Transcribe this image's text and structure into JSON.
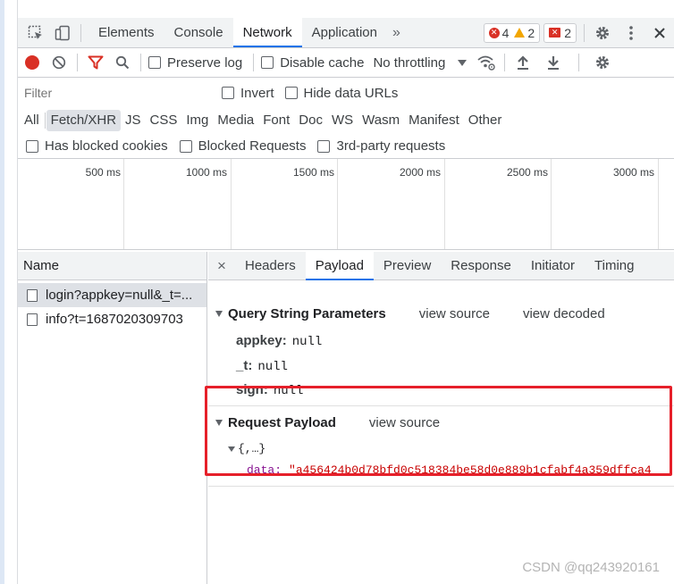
{
  "tabs": {
    "elements": "Elements",
    "console": "Console",
    "network": "Network",
    "application": "Application",
    "more": "»",
    "errors_count": "4",
    "warnings_count": "2",
    "issues_count": "2"
  },
  "toolbar": {
    "preserve_log": "Preserve log",
    "disable_cache": "Disable cache",
    "throttling": "No throttling"
  },
  "filter": {
    "placeholder": "Filter",
    "invert": "Invert",
    "hide_data_urls": "Hide data URLs"
  },
  "types": [
    "All",
    "Fetch/XHR",
    "JS",
    "CSS",
    "Img",
    "Media",
    "Font",
    "Doc",
    "WS",
    "Wasm",
    "Manifest",
    "Other"
  ],
  "blocked": {
    "has_blocked_cookies": "Has blocked cookies",
    "blocked_requests": "Blocked Requests",
    "third_party": "3rd-party requests"
  },
  "overview": {
    "ticks": [
      "500 ms",
      "1000 ms",
      "1500 ms",
      "2000 ms",
      "2500 ms",
      "3000 ms"
    ]
  },
  "requests": {
    "header": "Name",
    "items": [
      {
        "name": "login?appkey=null&_t=..."
      },
      {
        "name": "info?t=1687020309703"
      }
    ]
  },
  "details": {
    "close": "×",
    "tabs": [
      "Headers",
      "Payload",
      "Preview",
      "Response",
      "Initiator",
      "Timing"
    ],
    "active_tab": "Payload",
    "query": {
      "title": "Query String Parameters",
      "view_source": "view source",
      "view_decoded": "view decoded",
      "params": [
        {
          "key": "appkey:",
          "value": "null"
        },
        {
          "key": "_t:",
          "value": "null"
        },
        {
          "key": "sign:",
          "value": "null"
        }
      ]
    },
    "payload": {
      "title": "Request Payload",
      "view_source": "view source",
      "object_summary": "{,…}",
      "data_key": "data:",
      "data_value": "\"a456424b0d78bfd0c518384be58d0e889b1cfabf4a359dffca4"
    }
  },
  "watermark": "CSDN @qq243920161",
  "colors": {
    "accent": "#1a73e8",
    "record": "#d93025",
    "highlight": "#e6202a"
  }
}
